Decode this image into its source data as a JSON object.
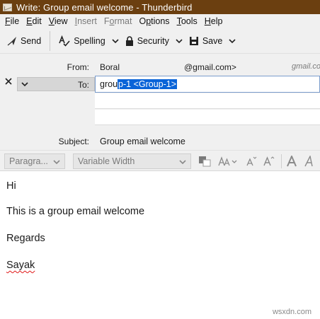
{
  "window": {
    "title": "Write: Group email welcome - Thunderbird"
  },
  "menu": [
    {
      "label": "File",
      "accel": "F",
      "rest": "ile",
      "disabled": false
    },
    {
      "label": "Edit",
      "accel": "E",
      "rest": "dit",
      "disabled": false
    },
    {
      "label": "View",
      "accel": "V",
      "rest": "iew",
      "disabled": false
    },
    {
      "label": "Insert",
      "accel": "I",
      "rest": "nsert",
      "disabled": true
    },
    {
      "label": "Format",
      "accel": "o",
      "rest": "rmat",
      "pre": "F",
      "disabled": true
    },
    {
      "label": "Options",
      "accel": "p",
      "rest": "tions",
      "pre": "O",
      "disabled": false
    },
    {
      "label": "Tools",
      "accel": "T",
      "rest": "ools",
      "disabled": false
    },
    {
      "label": "Help",
      "accel": "H",
      "rest": "elp",
      "disabled": false
    }
  ],
  "toolbar": {
    "send": "Send",
    "spelling": "Spelling",
    "security": "Security",
    "save": "Save"
  },
  "header": {
    "from_label": "From:",
    "from_name": "Boral",
    "from_email": "@gmail.com>",
    "from_trailing": "gmail.co",
    "to_label": "To:",
    "to_value_plain": "grou",
    "to_value_selected": "p-1 <Group-1>",
    "subject_label": "Subject:",
    "subject_value": "Group email welcome"
  },
  "format_bar": {
    "paragraph": "Paragra...",
    "font": "Variable Width"
  },
  "body": {
    "line1": "Hi",
    "line2": "This is a group email welcome",
    "line3": "Regards",
    "line4": "Sayak"
  },
  "watermark": "wsxdn.com",
  "colors": {
    "titlebar": "#6b3f10",
    "selection": "#0a64d8",
    "chrome": "#f0f0f0"
  }
}
